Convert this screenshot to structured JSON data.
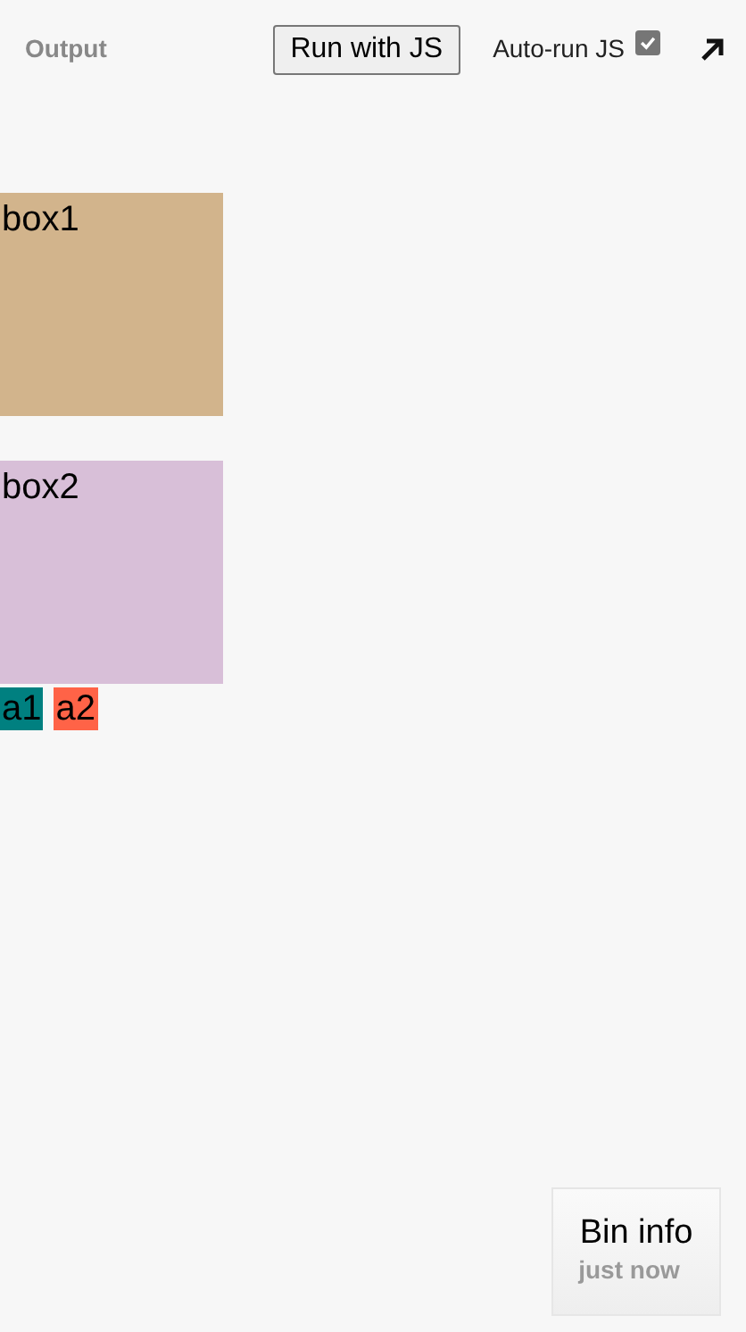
{
  "header": {
    "title": "Output",
    "run_button": "Run with JS",
    "autorun": {
      "label": "Auto-run JS",
      "checked": true
    }
  },
  "boxes": [
    {
      "label": "box1",
      "color": "#d2b48c"
    },
    {
      "label": "box2",
      "color": "#d8bfd8"
    }
  ],
  "inline_items": [
    {
      "label": "a1",
      "color": "#008080"
    },
    {
      "label": "a2",
      "color": "#ff6347"
    }
  ],
  "bin_info": {
    "title": "Bin info",
    "time": "just now"
  }
}
